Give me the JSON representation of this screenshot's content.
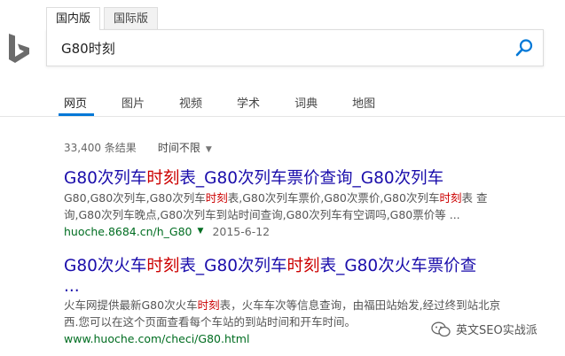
{
  "region_tabs": [
    "国内版",
    "国际版"
  ],
  "search": {
    "value": "G80时刻"
  },
  "nav": [
    "网页",
    "图片",
    "视频",
    "学术",
    "词典",
    "地图"
  ],
  "meta": {
    "count": "33,400 条结果",
    "time_filter": "时间不限"
  },
  "results": [
    {
      "title": [
        {
          "t": "G80次列车",
          "h": false
        },
        {
          "t": "时刻",
          "h": true
        },
        {
          "t": "表_G80次列车票价查询_G80次列车",
          "h": false
        }
      ],
      "snippet_1": [
        {
          "t": "G80,G80次列车,G80次列车",
          "h": false
        },
        {
          "t": "时刻",
          "h": true
        },
        {
          "t": "表,G80次列车票价,G80次票价,G80次列车",
          "h": false
        },
        {
          "t": "时刻",
          "h": true
        },
        {
          "t": "表 查",
          "h": false
        }
      ],
      "snippet_2": [
        {
          "t": "询,G80次列车晚点,G80次列车到站时间查询,G80次列车有空调吗,G80票价等 ...",
          "h": false
        }
      ],
      "url": "huoche.8684.cn/h_G80",
      "date": "2015-6-12"
    },
    {
      "title": [
        {
          "t": "G80次火车",
          "h": false
        },
        {
          "t": "时刻",
          "h": true
        },
        {
          "t": "表_G80次列车",
          "h": false
        },
        {
          "t": "时刻",
          "h": true
        },
        {
          "t": "表_G80次火车票价查",
          "h": false
        }
      ],
      "title_cont": "...",
      "snippet_1": [
        {
          "t": "火车网提供最新G80次火车",
          "h": false
        },
        {
          "t": "时刻",
          "h": true
        },
        {
          "t": "表，火车车次等信息查询，由福田站始发,经过终到站北京",
          "h": false
        }
      ],
      "snippet_2": [
        {
          "t": "西.您可以在这个页面查看每个车站的到站时间和开车时间。",
          "h": false
        }
      ],
      "url": "www.huoche.com/checi/G80.html"
    }
  ],
  "watermark": "英文SEO实战派",
  "colors": {
    "accent": "#0078d7",
    "link": "#1a0dab",
    "highlight": "#cc0000",
    "url": "#006d21"
  }
}
